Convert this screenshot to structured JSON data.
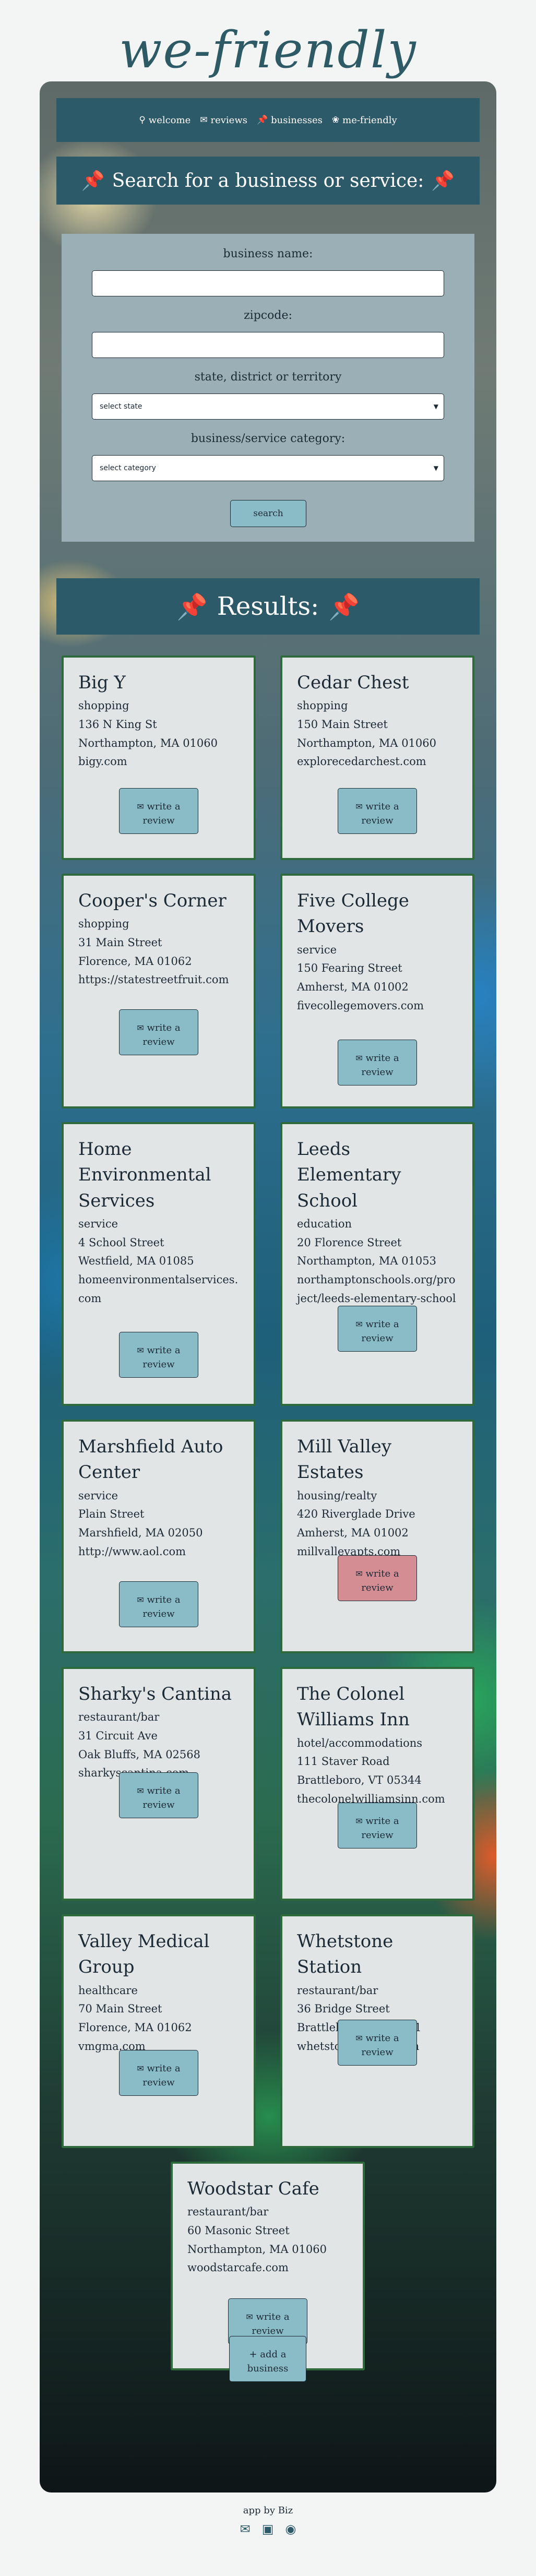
{
  "logo": "we-friendly",
  "nav": [
    {
      "label": "welcome",
      "icon": "lightbulb-icon"
    },
    {
      "label": "reviews",
      "icon": "chat-icon"
    },
    {
      "label": "businesses",
      "icon": "pushpin-icon"
    },
    {
      "label": "me-friendly",
      "icon": "brain-icon"
    }
  ],
  "search": {
    "title": "Search for a business or service:",
    "business_name_label": "business name:",
    "zipcode_label": "zipcode:",
    "state_label": "state, district or territory",
    "state_select": "select state",
    "category_label": "business/service category:",
    "category_select": "select category",
    "button": "search"
  },
  "results": {
    "title": "Results:",
    "review_label_line1": "write a",
    "review_label_line2": "review",
    "cards": [
      {
        "name": "Big Y",
        "category": "shopping",
        "street": "136 N King St",
        "city": "Northampton, MA 01060",
        "url": "bigy.com"
      },
      {
        "name": "Cedar Chest",
        "category": "shopping",
        "street": "150 Main Street",
        "city": "Northampton, MA 01060",
        "url": "explorecedarchest.com"
      },
      {
        "name": "Cooper's Corner",
        "category": "shopping",
        "street": "31 Main Street",
        "city": "Florence, MA 01062",
        "url": "https://statestreetfruit.com"
      },
      {
        "name": "Five College Movers",
        "category": "service",
        "street": "150 Fearing Street",
        "city": "Amherst, MA 01002",
        "url": "fivecollegemovers.com"
      },
      {
        "name": "Home Environmental Services",
        "category": "service",
        "street": "4 School Street",
        "city": "Westfield, MA 01085",
        "url": "homeenvironmentalservices.com"
      },
      {
        "name": "Leeds Elementary School",
        "category": "education",
        "street": "20 Florence Street",
        "city": "Northampton, MA 01053",
        "url": "northamptonschools.org/project/leeds-elementary-school"
      },
      {
        "name": "Marshfield Auto Center",
        "category": "service",
        "street": "Plain Street",
        "city": "Marshfield, MA 02050",
        "url": "http://www.aol.com"
      },
      {
        "name": "Mill Valley Estates",
        "category": "housing/realty",
        "street": "420 Riverglade Drive",
        "city": "Amherst, MA 01002",
        "url": "millvalleyapts.com"
      },
      {
        "name": "Sharky's Cantina",
        "category": "restaurant/bar",
        "street": "31 Circuit Ave",
        "city": "Oak Bluffs, MA 02568",
        "url": "sharkyscantina.com"
      },
      {
        "name": "The Colonel Williams Inn",
        "category": "hotel/accommodations",
        "street": "111 Staver Road",
        "city": "Brattleboro, VT 05344",
        "url": "thecolonelwilliamsinn.com"
      },
      {
        "name": "Valley Medical Group",
        "category": "healthcare",
        "street": "70 Main Street",
        "city": "Florence, MA 01062",
        "url": "vmgma.com"
      },
      {
        "name": "Whetstone Station",
        "category": "restaurant/bar",
        "street": "36 Bridge Street",
        "city": "Brattleboro, VT 05301",
        "url": "whetstonestation.com"
      },
      {
        "name": "Woodstar Cafe",
        "category": "restaurant/bar",
        "street": "60 Masonic Street",
        "city": "Northampton, MA 01060",
        "url": "woodstarcafe.com"
      }
    ]
  },
  "add_business": {
    "line1": "add a",
    "line2": "business"
  },
  "footer": {
    "credit": "app by Biz",
    "icons": [
      "envelope-icon",
      "linkedin-icon",
      "github-icon"
    ]
  },
  "colors": {
    "accent": "#2d5a68",
    "button": "#89bcc6",
    "card_border": "#2e6a3c",
    "card_bg": "#e1e5e6",
    "review_active": "#d58d94"
  }
}
